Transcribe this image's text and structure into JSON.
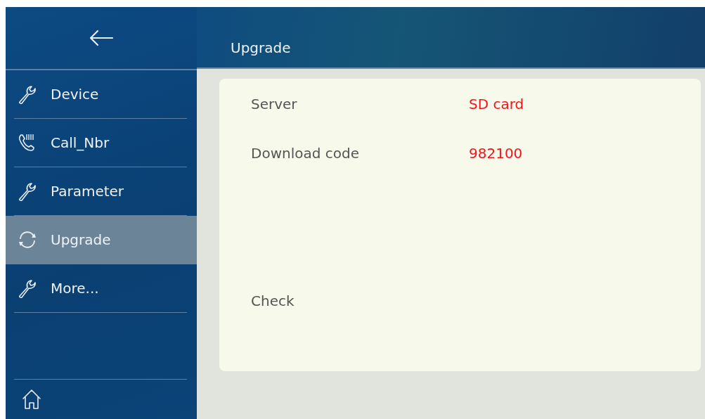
{
  "header": {
    "title": "Upgrade"
  },
  "sidebar": {
    "items": [
      {
        "label": "Device",
        "kind": "wrench",
        "selected": false
      },
      {
        "label": "Call_Nbr",
        "kind": "phone",
        "selected": false
      },
      {
        "label": "Parameter",
        "kind": "wrench",
        "selected": false
      },
      {
        "label": "Upgrade",
        "kind": "refresh",
        "selected": true
      },
      {
        "label": "More...",
        "kind": "wrench",
        "selected": false
      }
    ]
  },
  "settings": [
    {
      "label": "Server",
      "value": "SD card"
    },
    {
      "label": "Download code",
      "value": "982100"
    }
  ],
  "actions": [
    {
      "label": "Check"
    }
  ]
}
